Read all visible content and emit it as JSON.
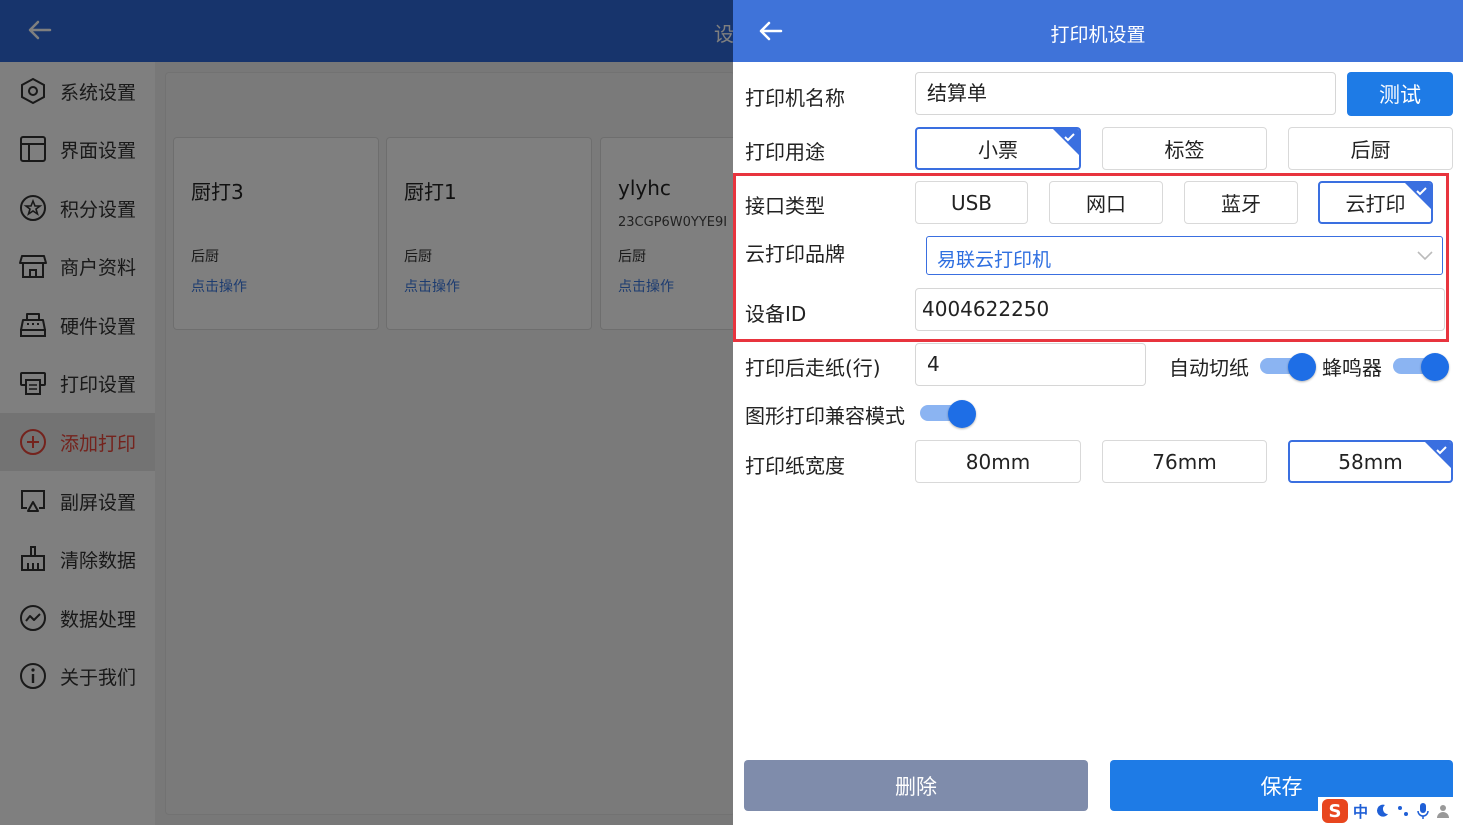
{
  "background": {
    "header_title": "设",
    "sidebar": [
      {
        "label": "系统设置",
        "icon": "hexagon-settings-icon"
      },
      {
        "label": "界面设置",
        "icon": "layout-icon"
      },
      {
        "label": "积分设置",
        "icon": "star-circle-icon"
      },
      {
        "label": "商户资料",
        "icon": "store-icon"
      },
      {
        "label": "硬件设置",
        "icon": "cash-register-icon"
      },
      {
        "label": "打印设置",
        "icon": "printer-icon"
      },
      {
        "label": "添加打印",
        "icon": "plus-circle-icon"
      },
      {
        "label": "副屏设置",
        "icon": "screen-icon"
      },
      {
        "label": "清除数据",
        "icon": "broom-icon"
      },
      {
        "label": "数据处理",
        "icon": "chart-circle-icon"
      },
      {
        "label": "关于我们",
        "icon": "info-icon"
      }
    ],
    "active_index": 6,
    "printers": [
      {
        "name": "厨打3",
        "serial": "",
        "use": "后厨",
        "action": "点击操作"
      },
      {
        "name": "厨打1",
        "serial": "",
        "use": "后厨",
        "action": "点击操作"
      },
      {
        "name": "ylyhc",
        "serial": "23CGP6W0YYE9I",
        "use": "后厨",
        "action": "点击操作"
      }
    ]
  },
  "dialog": {
    "title": "打印机设置",
    "name_label": "打印机名称",
    "name_value": "结算单",
    "test_button": "测试",
    "purpose_label": "打印用途",
    "purposes": [
      "小票",
      "标签",
      "后厨"
    ],
    "purpose_selected": 0,
    "interface_label": "接口类型",
    "interfaces": [
      "USB",
      "网口",
      "蓝牙",
      "云打印"
    ],
    "interface_selected": 3,
    "brand_label": "云打印品牌",
    "brand_value": "易联云打印机",
    "device_label": "设备ID",
    "device_value": "4004622250",
    "feed_label": "打印后走纸(行)",
    "feed_value": "4",
    "autocut_label": "自动切纸",
    "autocut_on": true,
    "buzzer_label": "蜂鸣器",
    "buzzer_on": true,
    "compat_label": "图形打印兼容模式",
    "compat_on": true,
    "width_label": "打印纸宽度",
    "widths": [
      "80mm",
      "76mm",
      "58mm"
    ],
    "width_selected": 2,
    "delete_button": "删除",
    "save_button": "保存"
  },
  "ime": {
    "mode": "中"
  },
  "colors": {
    "header_blue": "#3f73d9",
    "accent_blue": "#1e7be6",
    "highlight_red": "#e8343e",
    "delete_gray": "#7f8cab"
  }
}
